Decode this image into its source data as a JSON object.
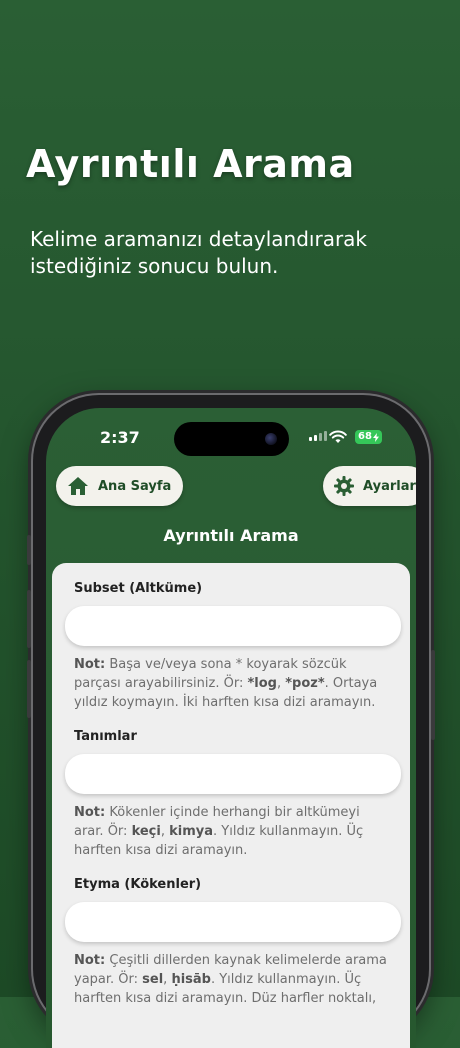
{
  "hero": {
    "title": "Ayrıntılı Arama",
    "subtitle": "Kelime aramanızı detaylandırarak istediğiniz sonucu bulun."
  },
  "status_bar": {
    "time": "2:37",
    "battery": "68"
  },
  "header": {
    "home_label": "Ana Sayfa",
    "settings_label": "Ayarlar",
    "title": "Ayrıntılı Arama"
  },
  "fields": [
    {
      "label": "Subset (Altküme)",
      "value": "",
      "note_prefix": "Not:",
      "note_a": "Başa ve/veya sona * koyarak sözcük parçası arayabilirsiniz. Ör: ",
      "ex1": "*log",
      "sep": ", ",
      "ex2": "*poz*",
      "note_b": ". Ortaya yıldız koymayın. İki harften kısa dizi aramayın."
    },
    {
      "label": "Tanımlar",
      "value": "",
      "note_prefix": "Not:",
      "note_a": "Kökenler içinde herhangi bir altkümeyi arar. Ör: ",
      "ex1": "keçi",
      "sep": ", ",
      "ex2": "kimya",
      "note_b": ". Yıldız kullanmayın. Üç harften kısa dizi aramayın."
    },
    {
      "label": "Etyma (Kökenler)",
      "value": "",
      "note_prefix": "Not:",
      "note_a": "Çeşitli dillerden kaynak kelimelerde arama yapar. Ör: ",
      "ex1": "sel",
      "sep": ", ",
      "ex2": "ḥisāb",
      "note_b": ". Yıldız kullanmayın. Üç harften kısa dizi aramayın. Düz harfler noktalı,"
    }
  ],
  "colors": {
    "brand_green": "#24552e",
    "button_bg": "#f3f2ec",
    "battery_green": "#35c759"
  },
  "icons": {
    "home": "house-icon",
    "settings": "gear-icon"
  }
}
